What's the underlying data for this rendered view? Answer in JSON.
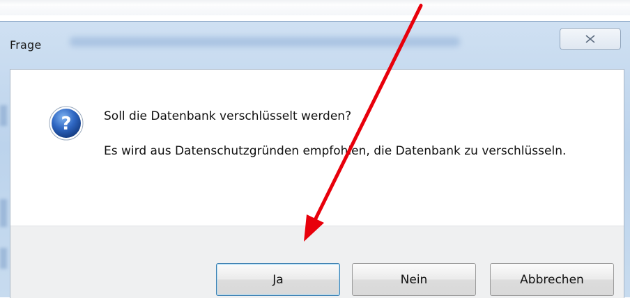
{
  "window": {
    "title": "Frage",
    "close_icon": "close-x-icon"
  },
  "dialog": {
    "icon": "question-icon",
    "message_line1": "Soll die Datenbank verschlüsselt werden?",
    "message_line2": "Es wird aus Datenschutzgründen empfohlen, die Datenbank zu verschlüsseln."
  },
  "buttons": {
    "yes": "Ja",
    "no": "Nein",
    "cancel": "Abbrechen"
  },
  "annotation": {
    "type": "red-arrow-pointing-to-ja-button",
    "color": "#e8000b"
  },
  "colors": {
    "title_bar": "#c6d9ee",
    "button_area": "#eff0f1",
    "default_button_border": "#3c7fb1",
    "question_icon": "#2c5fb5"
  }
}
